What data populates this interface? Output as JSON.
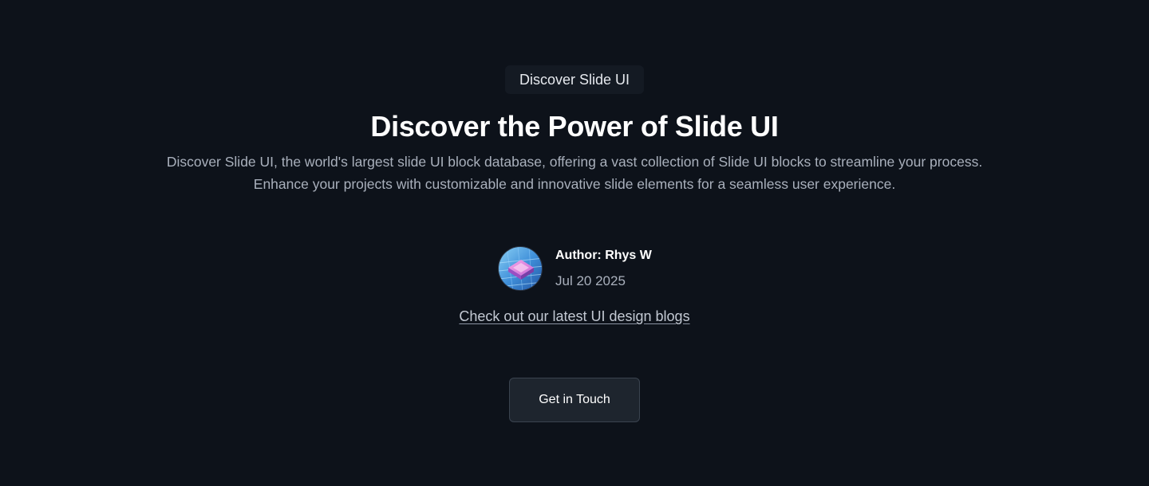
{
  "hero": {
    "badge": "Discover Slide UI",
    "title": "Discover the Power of Slide UI",
    "description": "Discover Slide UI, the world's largest slide UI block database, offering a vast collection of Slide UI blocks to streamline your process. Enhance your projects with customizable and innovative slide elements for a seamless user experience.",
    "author": {
      "name": "Author: Rhys W",
      "date": "Jul 20 2025",
      "avatar_icon": "avatar-image"
    },
    "blog_link": "Check out our latest UI design blogs",
    "cta_label": "Get in Touch"
  },
  "colors": {
    "background": "#0d121a",
    "badge_background": "#141a23",
    "muted_text": "#a9b0bc",
    "button_background": "#1e252e",
    "button_border": "#3a434f"
  }
}
